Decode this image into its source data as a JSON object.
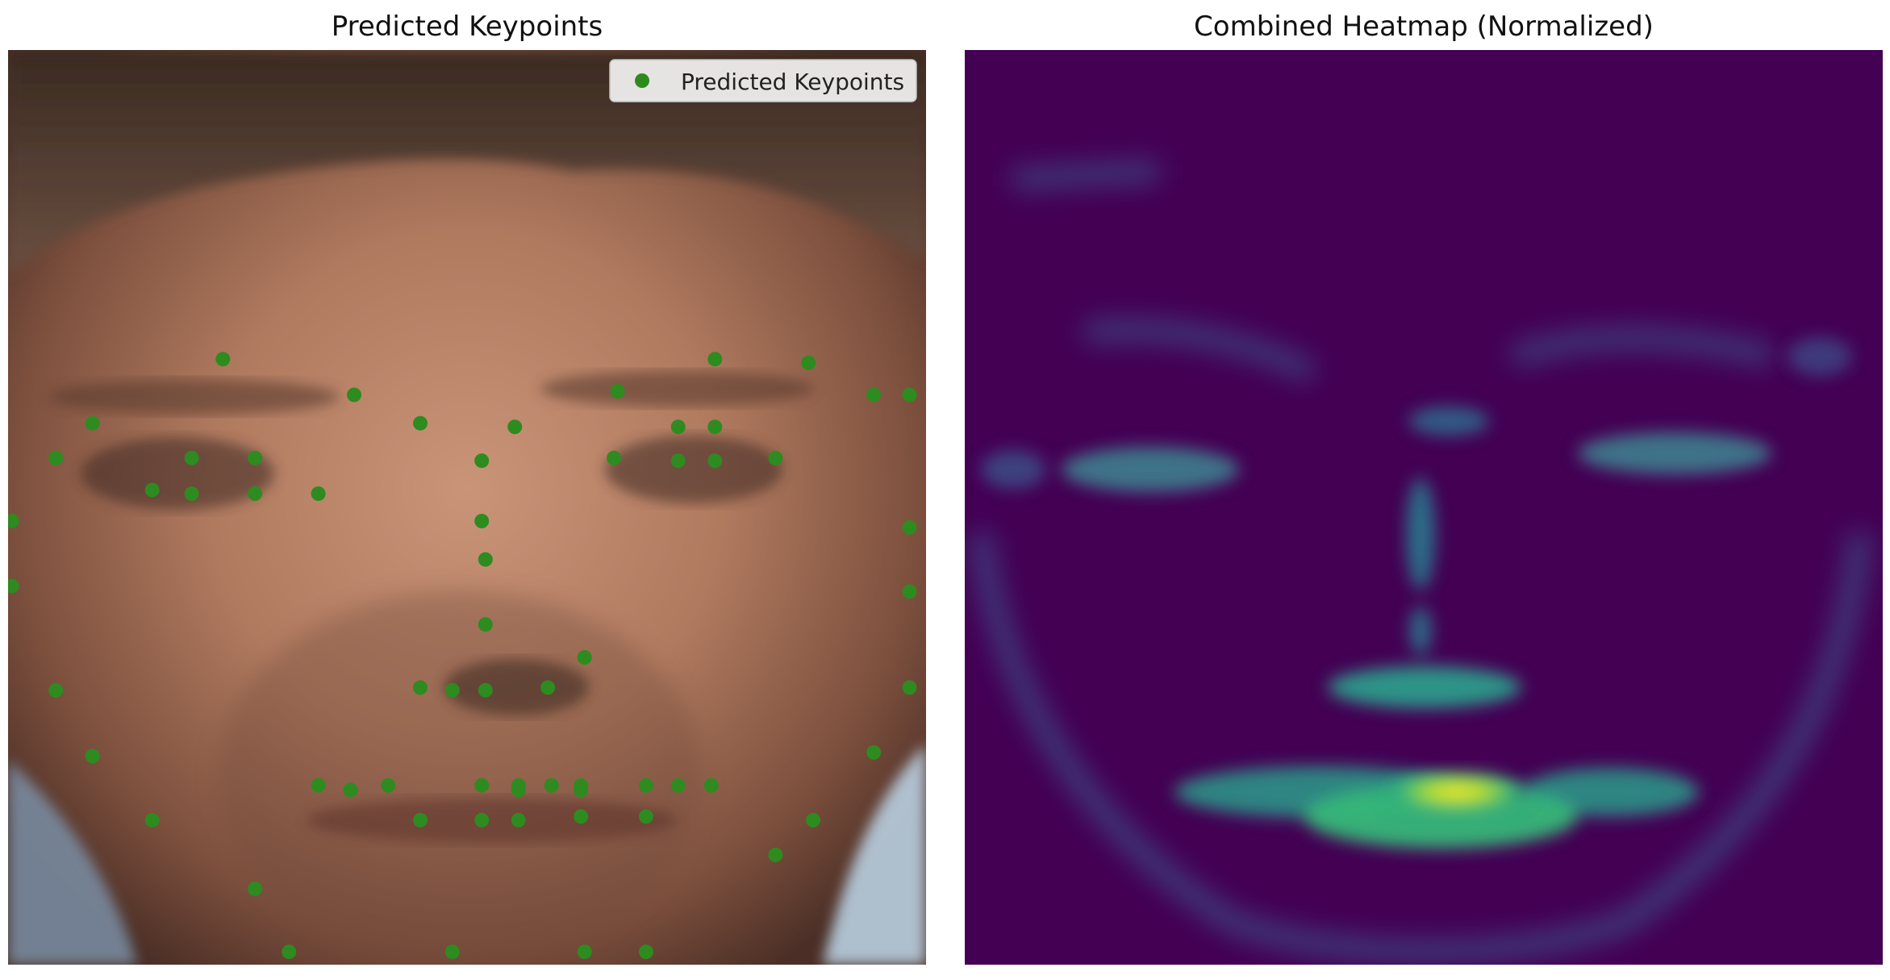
{
  "chart_data": [
    {
      "type": "scatter",
      "title": "Predicted Keypoints",
      "xlim": [
        0,
        1
      ],
      "ylim": [
        1,
        0
      ],
      "legend": {
        "position": "top-right",
        "entries": [
          "Predicted Keypoints"
        ]
      },
      "colors": {
        "marker": "#2e8b1f",
        "legend_bg": "#f4f4f4"
      },
      "series": [
        {
          "name": "Predicted Keypoints",
          "points": [
            {
              "x": 0.234,
              "y": 0.338
            },
            {
              "x": 0.377,
              "y": 0.377
            },
            {
              "x": 0.092,
              "y": 0.408
            },
            {
              "x": 0.449,
              "y": 0.408
            },
            {
              "x": 0.664,
              "y": 0.373
            },
            {
              "x": 0.77,
              "y": 0.338
            },
            {
              "x": 0.872,
              "y": 0.342
            },
            {
              "x": 0.943,
              "y": 0.377
            },
            {
              "x": 0.982,
              "y": 0.377
            },
            {
              "x": 0.052,
              "y": 0.446
            },
            {
              "x": 0.2,
              "y": 0.446
            },
            {
              "x": 0.269,
              "y": 0.446
            },
            {
              "x": 0.157,
              "y": 0.481
            },
            {
              "x": 0.2,
              "y": 0.485
            },
            {
              "x": 0.269,
              "y": 0.485
            },
            {
              "x": 0.338,
              "y": 0.485
            },
            {
              "x": 0.552,
              "y": 0.412
            },
            {
              "x": 0.73,
              "y": 0.412
            },
            {
              "x": 0.77,
              "y": 0.412
            },
            {
              "x": 0.516,
              "y": 0.449
            },
            {
              "x": 0.66,
              "y": 0.446
            },
            {
              "x": 0.73,
              "y": 0.449
            },
            {
              "x": 0.77,
              "y": 0.449
            },
            {
              "x": 0.836,
              "y": 0.446
            },
            {
              "x": 0.516,
              "y": 0.515
            },
            {
              "x": 0.52,
              "y": 0.557
            },
            {
              "x": 0.52,
              "y": 0.628
            },
            {
              "x": 0.628,
              "y": 0.664
            },
            {
              "x": 0.449,
              "y": 0.697
            },
            {
              "x": 0.484,
              "y": 0.7
            },
            {
              "x": 0.52,
              "y": 0.7
            },
            {
              "x": 0.588,
              "y": 0.697
            },
            {
              "x": 0.004,
              "y": 0.515
            },
            {
              "x": 0.004,
              "y": 0.586
            },
            {
              "x": 0.982,
              "y": 0.522
            },
            {
              "x": 0.982,
              "y": 0.592
            },
            {
              "x": 0.052,
              "y": 0.7
            },
            {
              "x": 0.092,
              "y": 0.772
            },
            {
              "x": 0.157,
              "y": 0.842
            },
            {
              "x": 0.269,
              "y": 0.917
            },
            {
              "x": 0.306,
              "y": 0.986
            },
            {
              "x": 0.484,
              "y": 0.986
            },
            {
              "x": 0.628,
              "y": 0.986
            },
            {
              "x": 0.695,
              "y": 0.986
            },
            {
              "x": 0.982,
              "y": 0.697
            },
            {
              "x": 0.943,
              "y": 0.768
            },
            {
              "x": 0.877,
              "y": 0.842
            },
            {
              "x": 0.836,
              "y": 0.88
            },
            {
              "x": 0.338,
              "y": 0.804
            },
            {
              "x": 0.373,
              "y": 0.809
            },
            {
              "x": 0.414,
              "y": 0.804
            },
            {
              "x": 0.516,
              "y": 0.804
            },
            {
              "x": 0.556,
              "y": 0.804
            },
            {
              "x": 0.556,
              "y": 0.809
            },
            {
              "x": 0.592,
              "y": 0.804
            },
            {
              "x": 0.624,
              "y": 0.804
            },
            {
              "x": 0.624,
              "y": 0.809
            },
            {
              "x": 0.695,
              "y": 0.804
            },
            {
              "x": 0.73,
              "y": 0.804
            },
            {
              "x": 0.766,
              "y": 0.804
            },
            {
              "x": 0.449,
              "y": 0.842
            },
            {
              "x": 0.516,
              "y": 0.842
            },
            {
              "x": 0.556,
              "y": 0.842
            },
            {
              "x": 0.624,
              "y": 0.838
            },
            {
              "x": 0.695,
              "y": 0.838
            }
          ]
        }
      ]
    },
    {
      "type": "heatmap",
      "title": "Combined Heatmap (Normalized)",
      "colormap": "viridis",
      "colors": {
        "background": "#440154",
        "low": "#3b528b",
        "mid": "#21918c",
        "high": "#5ec962",
        "peak": "#fde725"
      }
    }
  ]
}
